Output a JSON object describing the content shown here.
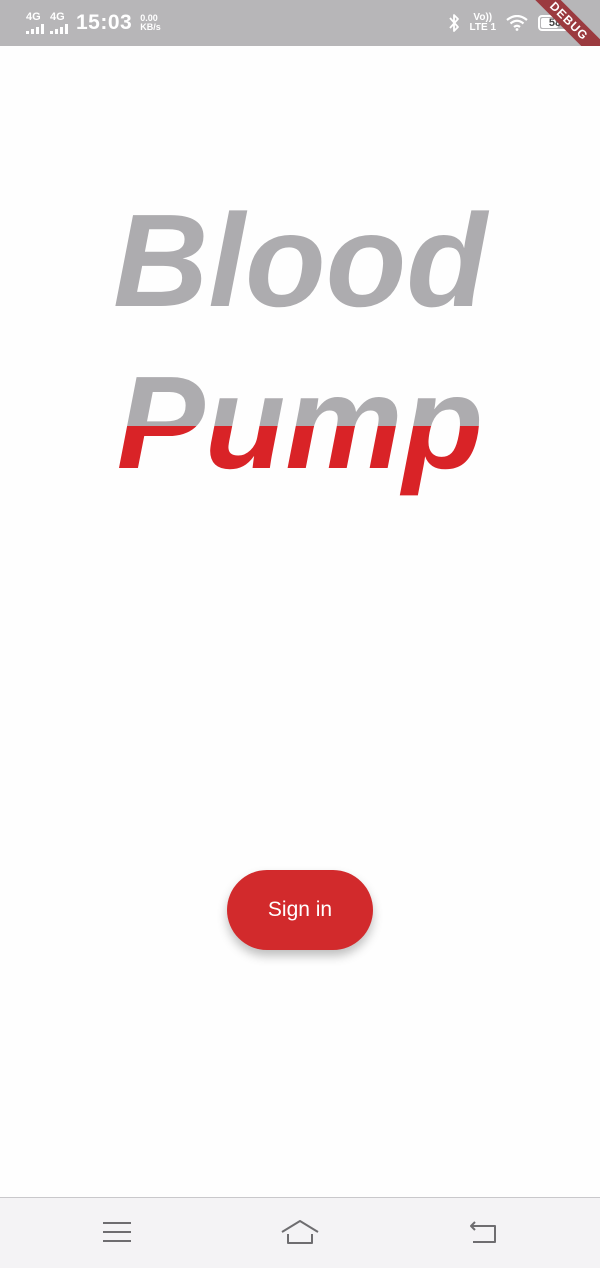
{
  "status_bar": {
    "signal_1_label": "4G",
    "signal_2_label": "4G",
    "time": "15:03",
    "net_speed_value": "0.00",
    "net_speed_unit": "KB/s",
    "volte_top": "Vo))",
    "volte_bottom": "LTE 1",
    "battery_level": "58",
    "icons": [
      "bluetooth-icon",
      "wifi-icon",
      "battery-icon"
    ]
  },
  "debug_banner": {
    "label": "DEBUG"
  },
  "app": {
    "title_line_1": "Blood",
    "title_line_2": "Pump",
    "sign_in_label": "Sign in",
    "colors": {
      "title_gray": "#adacaf",
      "blood_red": "#d92327",
      "button_red": "#d22a2c"
    }
  },
  "nav_bar": {
    "icons": [
      "menu-icon",
      "home-icon",
      "back-icon"
    ]
  }
}
